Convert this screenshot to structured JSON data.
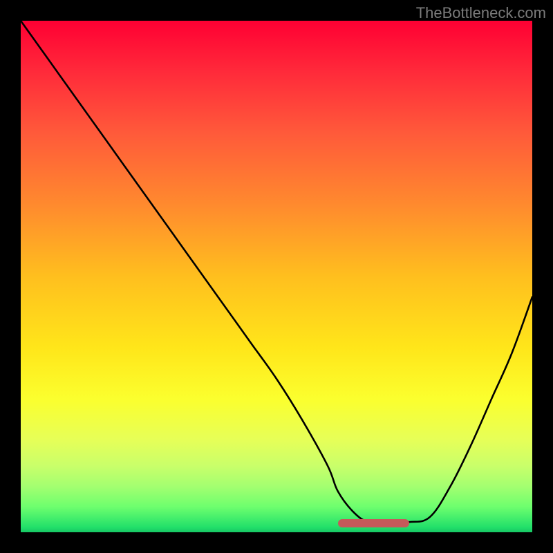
{
  "attribution": "TheBottleneck.com",
  "colors": {
    "frame": "#000000",
    "curve_stroke": "#000000",
    "baseline_segment": "#C55A5A",
    "attribution_text": "#7B7B7B",
    "gradient_top": "#FF0033",
    "gradient_bottom": "#17C765"
  },
  "chart_data": {
    "type": "line",
    "title": "",
    "xlabel": "",
    "ylabel": "",
    "xlim": [
      0,
      100
    ],
    "ylim": [
      0,
      100
    ],
    "grid": false,
    "series": [
      {
        "name": "bottleneck_curve",
        "x": [
          0,
          5,
          10,
          15,
          20,
          25,
          30,
          35,
          40,
          45,
          50,
          55,
          60,
          62,
          65,
          68,
          72,
          76,
          80,
          84,
          88,
          92,
          96,
          100
        ],
        "values": [
          100,
          93,
          86,
          79,
          72,
          65,
          58,
          51,
          44,
          37,
          30,
          22,
          13,
          8,
          4,
          2,
          2,
          2,
          3,
          9,
          17,
          26,
          35,
          46
        ]
      }
    ],
    "baseline_segment": {
      "x_start": 62,
      "x_end": 76,
      "y": 1.8
    },
    "notes": "Background is a vertical red→yellow→green gradient; curve is a V-shaped bottleneck profile with its minimum plateau near x≈62–76; a short pink rounded segment marks the flat bottom."
  }
}
